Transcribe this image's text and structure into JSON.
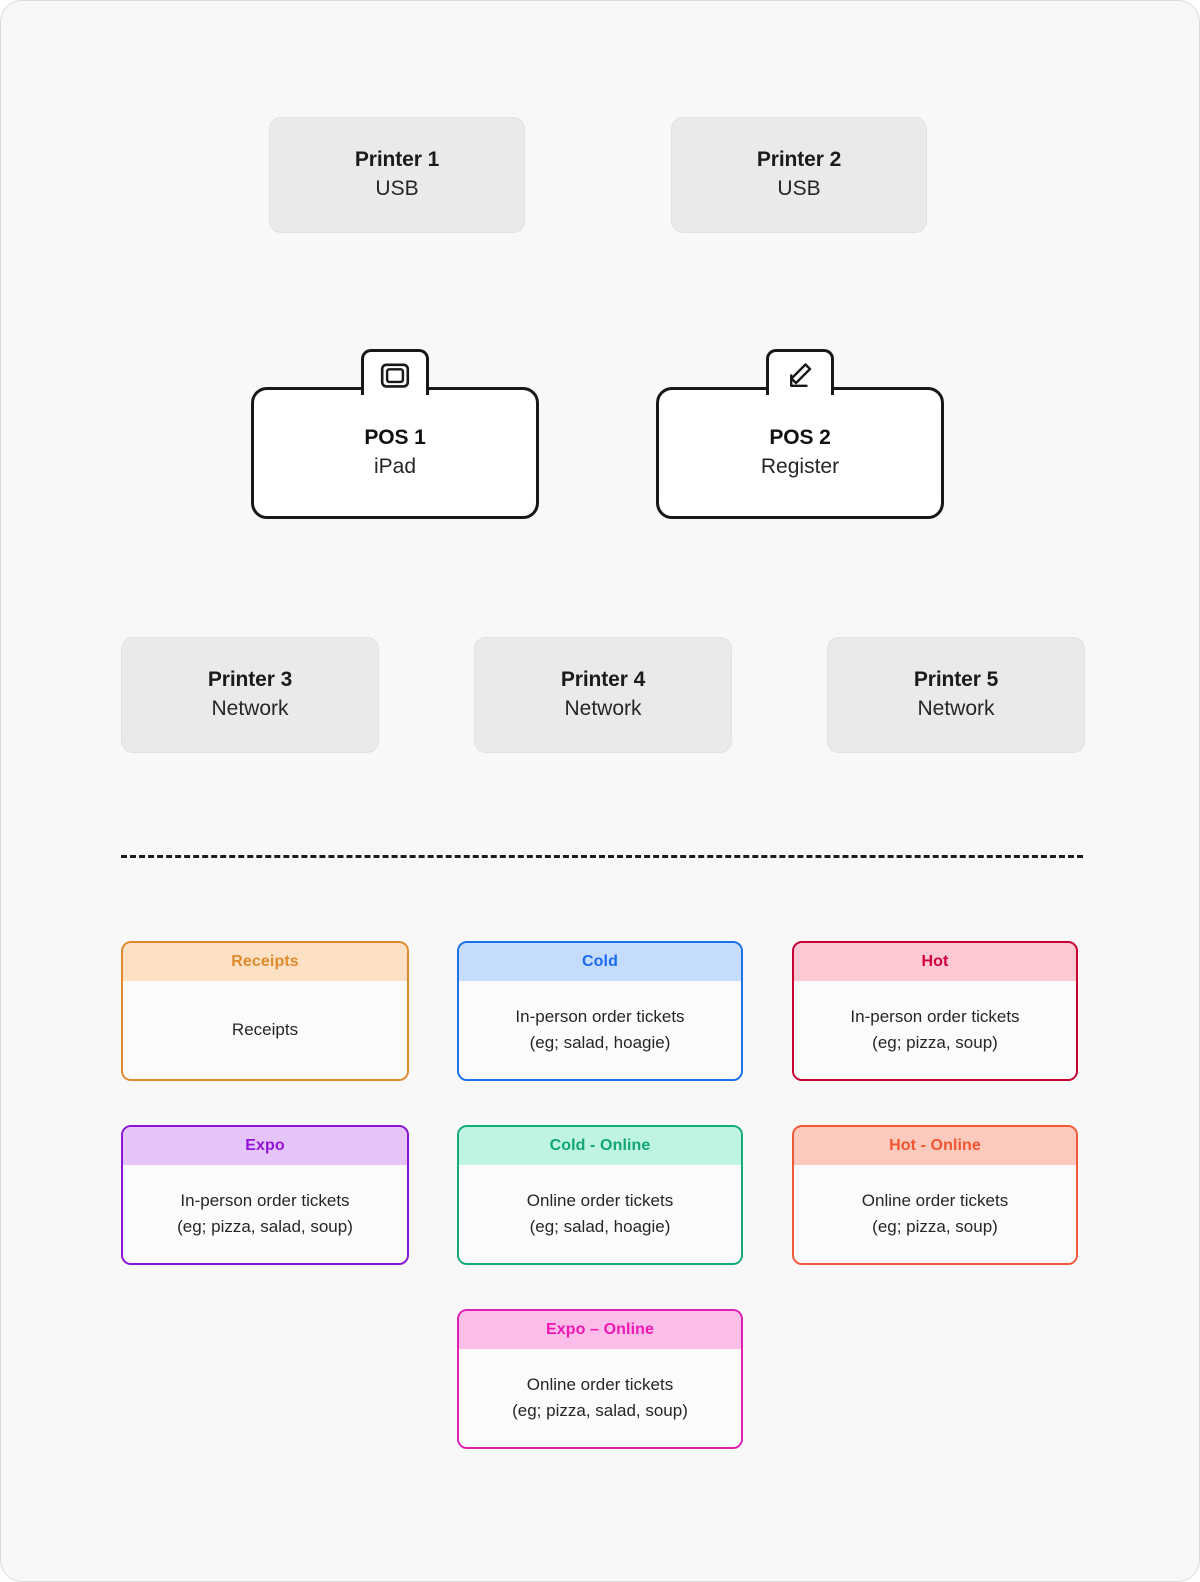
{
  "canvas": {
    "background": "#f8f8f8",
    "border_color": "#dcdcdc"
  },
  "printers_usb": [
    {
      "name": "Printer 1",
      "connection": "USB",
      "icon": "printer-icon"
    },
    {
      "name": "Printer 2",
      "connection": "USB",
      "icon": "printer-icon"
    }
  ],
  "pos_devices": [
    {
      "name": "POS 1",
      "device": "iPad",
      "icon": "tablet-icon"
    },
    {
      "name": "POS 2",
      "device": "Register",
      "icon": "register-icon"
    }
  ],
  "printers_network": [
    {
      "name": "Printer 3",
      "connection": "Network",
      "icon": "printer-icon"
    },
    {
      "name": "Printer 4",
      "connection": "Network",
      "icon": "printer-icon"
    },
    {
      "name": "Printer 5",
      "connection": "Network",
      "icon": "printer-icon"
    }
  ],
  "ticket_cards": [
    {
      "title": "Receipts",
      "line1": "Receipts",
      "line2": "",
      "border_color": "#e08a2e",
      "header_bg": "#fbe0c4",
      "title_color": "#e08a2e"
    },
    {
      "title": "Cold",
      "line1": "In-person order tickets",
      "line2": "(eg; salad, hoagie)",
      "border_color": "#1a73e8",
      "header_bg": "#c5dcfc",
      "title_color": "#1a6af0"
    },
    {
      "title": "Hot",
      "line1": "In-person order tickets",
      "line2": "(eg; pizza, soup)",
      "border_color": "#c80032",
      "header_bg": "#fcc9d3",
      "title_color": "#d4003c"
    },
    {
      "title": "Expo",
      "line1": "In-person order tickets",
      "line2": "(eg; pizza, salad, soup)",
      "border_color": "#8b14d6",
      "header_bg": "#e5c4fa",
      "title_color": "#9413d9"
    },
    {
      "title": "Cold - Online",
      "line1": "Online order tickets",
      "line2": "(eg; salad, hoagie)",
      "border_color": "#14a87a",
      "header_bg": "#bff4e0",
      "title_color": "#11a676"
    },
    {
      "title": "Hot - Online",
      "line1": "Online order tickets",
      "line2": "(eg; pizza, soup)",
      "border_color": "#f05a38",
      "header_bg": "#fccabd",
      "title_color": "#f2542f"
    },
    {
      "title": "Expo – Online",
      "line1": "Online order tickets",
      "line2": "(eg; pizza, salad, soup)",
      "border_color": "#e020b4",
      "header_bg": "#fcbde8",
      "title_color": "#ec17b4"
    }
  ]
}
